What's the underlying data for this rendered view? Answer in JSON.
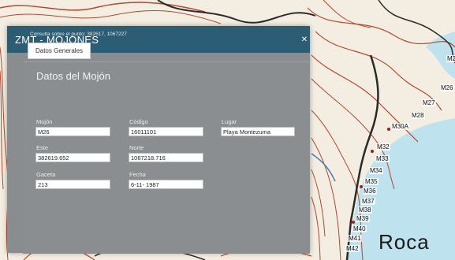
{
  "dialog": {
    "title": "ZMT - MOJONES",
    "close_icon": "close-icon",
    "query_text": "Consulta sobre el punto: 382617, 1067227",
    "tab_label": "Datos Generales",
    "section_title": "Datos del Mojón",
    "fields": {
      "mojon": {
        "label": "Mojón",
        "value": "M26"
      },
      "codigo": {
        "label": "Código",
        "value": "16011101"
      },
      "lugar": {
        "label": "Lugar",
        "value": "Playa Montezuma"
      },
      "este": {
        "label": "Este",
        "value": "382619.652"
      },
      "norte": {
        "label": "Norte",
        "value": "1067218.716"
      },
      "gaceta": {
        "label": "Gaceta",
        "value": "213"
      },
      "fecha": {
        "label": "Fecha",
        "value": "6-11- 1987"
      }
    }
  },
  "map": {
    "place_label": "Roca",
    "markers": [
      "M2",
      "M26",
      "M27",
      "M28",
      "M30A",
      "M32",
      "M33",
      "M34",
      "M35",
      "M36",
      "M37",
      "M38",
      "M39",
      "M40",
      "M41",
      "M42"
    ],
    "colors": {
      "contour": "#b3472f",
      "water": "#bfe2ef",
      "paper": "#f4eee2",
      "header": "#2b5d74",
      "dialog": "#8a8d8f"
    }
  }
}
